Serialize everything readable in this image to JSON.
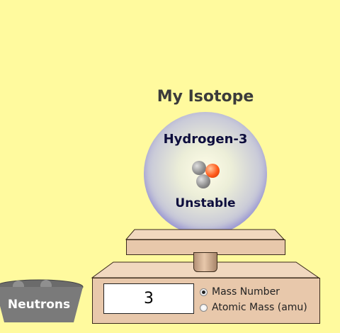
{
  "title": "My Isotope",
  "atom": {
    "element_name": "Hydrogen-3",
    "stability": "Unstable"
  },
  "scale": {
    "readout_value": "3",
    "options": [
      {
        "label": "Mass Number",
        "selected": true
      },
      {
        "label": "Atomic Mass (amu)",
        "selected": false
      }
    ]
  },
  "bucket": {
    "label": "Neutrons"
  },
  "colors": {
    "background": "#FFFA9E",
    "proton": "#FF5A1A",
    "neutron": "#8E8E8E",
    "scale": "#E8C8AB"
  }
}
